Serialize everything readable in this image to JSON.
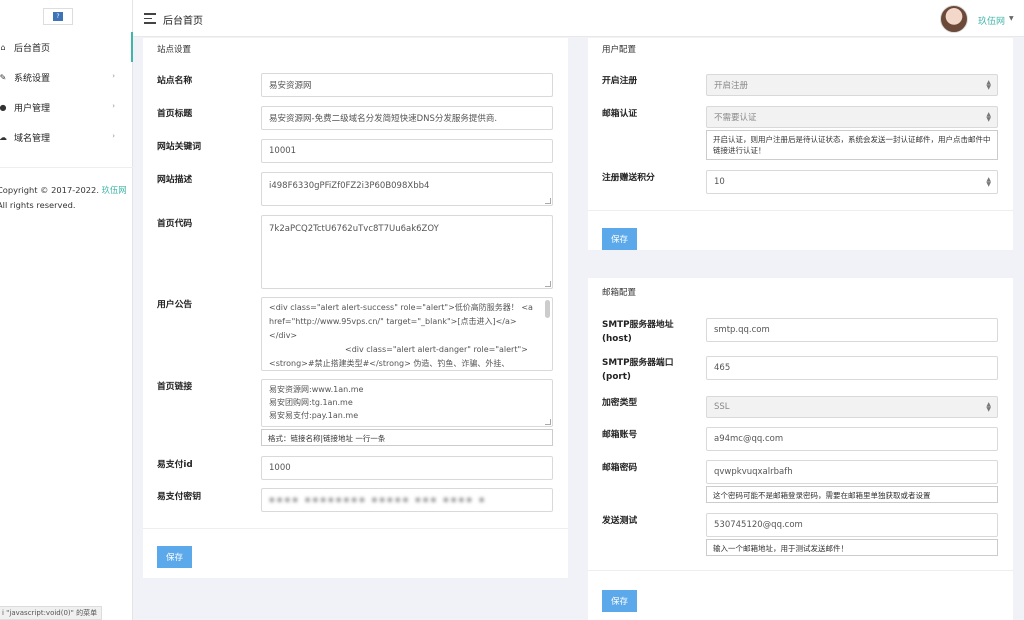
{
  "sidebar": {
    "logo_text": "?",
    "items": [
      {
        "label": "后台首页",
        "icon": "home-icon",
        "active": true,
        "glyph": "⌂",
        "has_arrow": false
      },
      {
        "label": "系统设置",
        "icon": "palette-icon",
        "active": false,
        "glyph": "✎",
        "has_arrow": true
      },
      {
        "label": "用户管理",
        "icon": "user-icon",
        "active": false,
        "glyph": "●",
        "has_arrow": true
      },
      {
        "label": "域名管理",
        "icon": "cloud-icon",
        "active": false,
        "glyph": "☁",
        "has_arrow": true
      }
    ],
    "copyright_prefix": "Copyright © 2017-2022.",
    "copyright_brand": "玖伍网",
    "copyright_suffix": "All rights reserved.",
    "status_url": "i \"javascript:void(0)\" 的菜单"
  },
  "header": {
    "title": "后台首页",
    "username": "玖伍网"
  },
  "site_settings": {
    "title": "站点设置",
    "site_name_label": "站点名称",
    "site_name_value": "易安资源网",
    "home_title_label": "首页标题",
    "home_title_value": "易安资源网-免费二级域名分发简短快速DNS分发服务提供商.",
    "keywords_label": "网站关键词",
    "keywords_value": "10001",
    "description_label": "网站描述",
    "description_value": "i498F6330gPFiZf0FZ2i3P60B098Xbb4",
    "code_label": "首页代码",
    "code_value": "7k2aPCQ2TctU6762uTvc8T7Uu6ak6ZOY",
    "notice_label": "用户公告",
    "notice_lines": [
      "<div class=\"alert alert-success\" role=\"alert\">低价高防服务器！ <a",
      "href=\"http://www.95vps.cn/\" target=\"_blank\">[点击进入]</a>",
      "</div>",
      "<div class=\"alert alert-danger\" role=\"alert\">",
      "<strong>#禁止搭建类型#</strong> 伪造、钓鱼、诈骗、外挂、"
    ],
    "links_label": "首页链接",
    "links_lines": [
      "易安资源网:www.1an.me",
      "易安团购网:tg.1an.me",
      "易安易支付:pay.1an.me"
    ],
    "links_hint": "格式：链接名称|链接地址 一行一条",
    "pay_id_label": "易支付id",
    "pay_id_value": "1000",
    "pay_key_label": "易支付密钥",
    "pay_key_value": "▪▪▪▪ ▪▪▪▪▪▪▪▪ ▪▪▪▪▪ ▪▪▪ ▪▪▪▪ ▪",
    "save_label": "保存"
  },
  "user_settings": {
    "title": "用户配置",
    "register_label": "开启注册",
    "register_value": "开启注册",
    "email_verify_label": "邮箱认证",
    "email_verify_value": "不需要认证",
    "email_verify_hint": "开启认证，则用户注册后是待认证状态，系统会发送一封认证邮件，用户点击邮件中链接进行认证！",
    "points_label": "注册赠送积分",
    "points_value": "10",
    "save_label": "保存"
  },
  "mail_settings": {
    "title": "邮箱配置",
    "smtp_host_label": "SMTP服务器地址",
    "smtp_host_sub": "(host)",
    "smtp_host_value": "smtp.qq.com",
    "smtp_port_label": "SMTP服务器端口",
    "smtp_port_sub": "(port)",
    "smtp_port_value": "465",
    "encrypt_label": "加密类型",
    "encrypt_value": "SSL",
    "account_label": "邮箱账号",
    "account_value": "a94mc@qq.com",
    "password_label": "邮箱密码",
    "password_value": "qvwpkvuqxalrbafh",
    "password_hint": "这个密码可能不是邮箱登录密码，需要在邮箱里单独获取或者设置",
    "test_label": "发送测试",
    "test_value": "530745120@qq.com",
    "test_hint": "输入一个邮箱地址，用于测试发送邮件！",
    "save_label": "保存"
  },
  "colors": {
    "accent": "#3fb6a7",
    "button": "#5ba8ea",
    "background": "#f1f2f7"
  }
}
